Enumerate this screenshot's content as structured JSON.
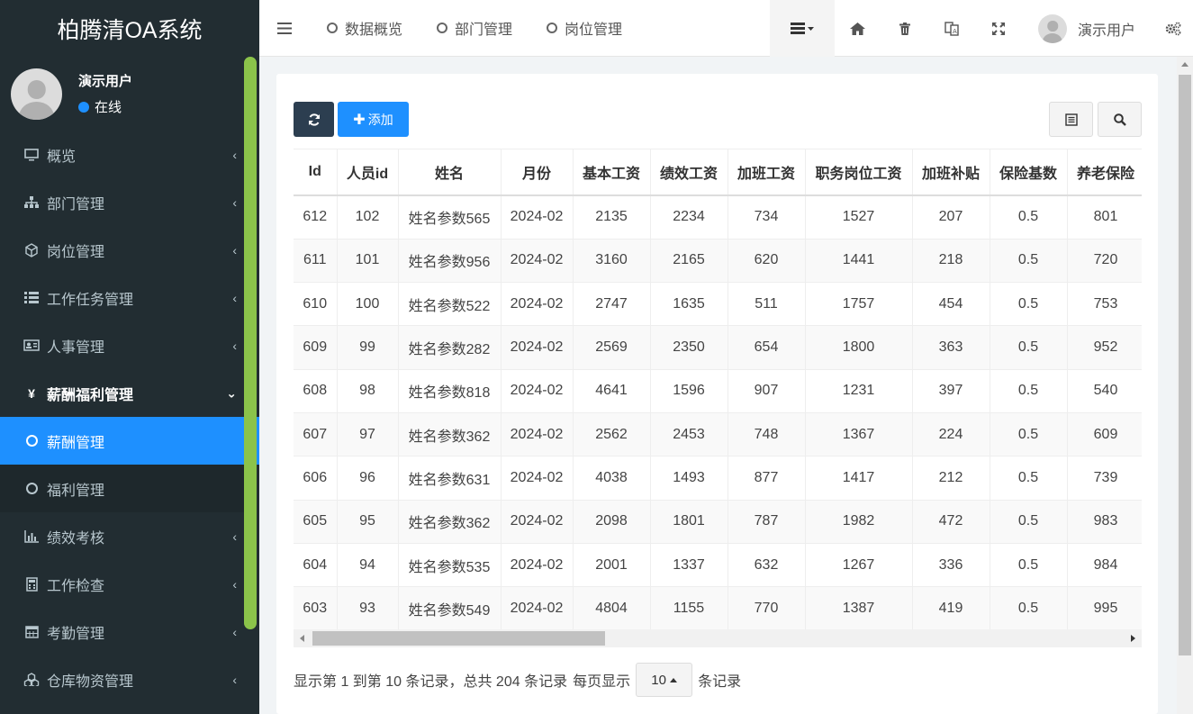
{
  "app": {
    "title": "柏腾清OA系统"
  },
  "user": {
    "name": "演示用户",
    "status": "在线"
  },
  "sidebar": {
    "items": [
      {
        "label": "概览"
      },
      {
        "label": "部门管理"
      },
      {
        "label": "岗位管理"
      },
      {
        "label": "工作任务管理"
      },
      {
        "label": "人事管理"
      },
      {
        "label": "薪酬福利管理"
      },
      {
        "label": "薪酬管理"
      },
      {
        "label": "福利管理"
      },
      {
        "label": "绩效考核"
      },
      {
        "label": "工作检查"
      },
      {
        "label": "考勤管理"
      },
      {
        "label": "仓库物资管理"
      }
    ]
  },
  "topbar": {
    "tabs": [
      {
        "label": "数据概览"
      },
      {
        "label": "部门管理"
      },
      {
        "label": "岗位管理"
      }
    ],
    "user_name": "演示用户"
  },
  "toolbar": {
    "add_label": "添加"
  },
  "table": {
    "headers": [
      "Id",
      "人员id",
      "姓名",
      "月份",
      "基本工资",
      "绩效工资",
      "加班工资",
      "职务岗位工资",
      "加班补贴",
      "保险基数",
      "养老保险"
    ],
    "rows": [
      [
        "612",
        "102",
        "姓名参数565",
        "2024-02",
        "2135",
        "2234",
        "734",
        "1527",
        "207",
        "0.5",
        "801"
      ],
      [
        "611",
        "101",
        "姓名参数956",
        "2024-02",
        "3160",
        "2165",
        "620",
        "1441",
        "218",
        "0.5",
        "720"
      ],
      [
        "610",
        "100",
        "姓名参数522",
        "2024-02",
        "2747",
        "1635",
        "511",
        "1757",
        "454",
        "0.5",
        "753"
      ],
      [
        "609",
        "99",
        "姓名参数282",
        "2024-02",
        "2569",
        "2350",
        "654",
        "1800",
        "363",
        "0.5",
        "952"
      ],
      [
        "608",
        "98",
        "姓名参数818",
        "2024-02",
        "4641",
        "1596",
        "907",
        "1231",
        "397",
        "0.5",
        "540"
      ],
      [
        "607",
        "97",
        "姓名参数362",
        "2024-02",
        "2562",
        "2453",
        "748",
        "1367",
        "224",
        "0.5",
        "609"
      ],
      [
        "606",
        "96",
        "姓名参数631",
        "2024-02",
        "4038",
        "1493",
        "877",
        "1417",
        "212",
        "0.5",
        "739"
      ],
      [
        "605",
        "95",
        "姓名参数362",
        "2024-02",
        "2098",
        "1801",
        "787",
        "1982",
        "472",
        "0.5",
        "983"
      ],
      [
        "604",
        "94",
        "姓名参数535",
        "2024-02",
        "2001",
        "1337",
        "632",
        "1267",
        "336",
        "0.5",
        "984"
      ],
      [
        "603",
        "93",
        "姓名参数549",
        "2024-02",
        "4804",
        "1155",
        "770",
        "1387",
        "419",
        "0.5",
        "995"
      ]
    ]
  },
  "pager": {
    "summary": "显示第 1 到第 10 条记录，总共 204 条记录",
    "per_page_prefix": "每页显示",
    "page_size": "10",
    "per_page_suffix": "条记录"
  },
  "colors": {
    "sidebar_bg": "#222d32",
    "accent": "#1e90ff",
    "dark_button": "#2c3e50",
    "scroll_green": "#8bc34a"
  }
}
